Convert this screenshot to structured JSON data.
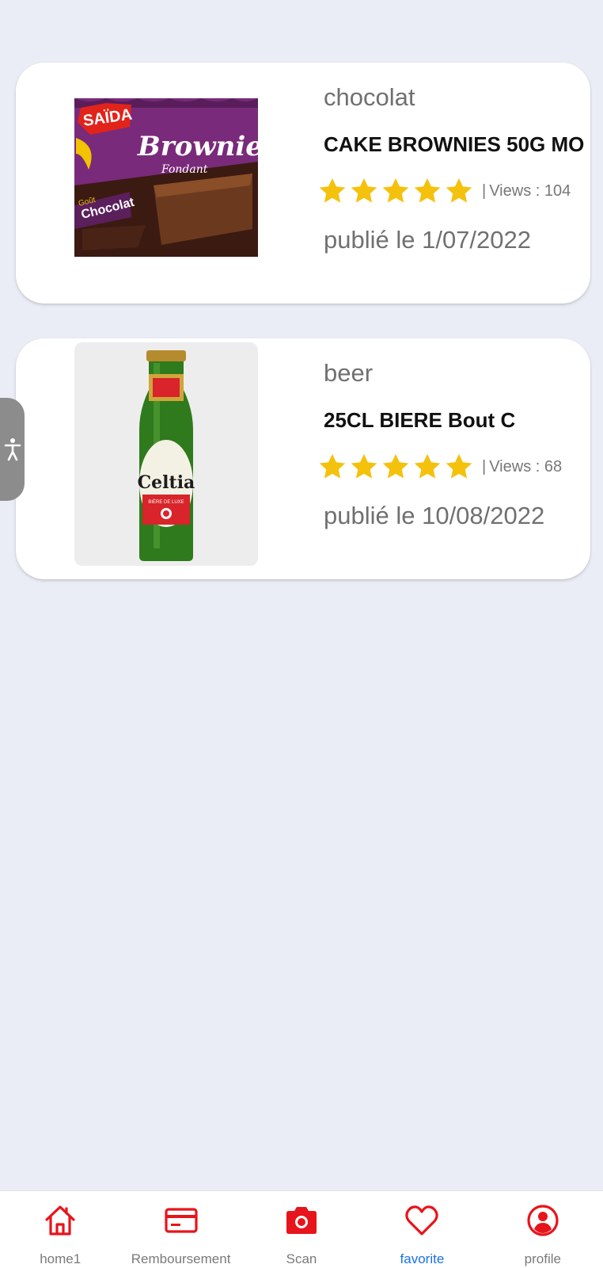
{
  "colors": {
    "accent_red": "#e8141b",
    "star_gold": "#f4c20d",
    "active_blue": "#1a73e8",
    "background": "#eaedf5"
  },
  "products": [
    {
      "category": "chocolat",
      "title": "CAKE BROWNIES 50G MO",
      "rating": 5,
      "views_label": "Views : 104",
      "date": "publié le 1/07/2022",
      "image": {
        "brand": "SAÏDA",
        "name": "Brownie",
        "subname": "Fondant",
        "flavor_1": "Goût",
        "flavor_2": "Chocolat"
      }
    },
    {
      "category": "beer",
      "title": "25CL BIERE Bout C",
      "rating": 5,
      "views_label": "Views : 68",
      "date": "publié le 10/08/2022",
      "image": {
        "brand": "Celtia",
        "subname": "BIÈRE DE LUXE"
      }
    }
  ],
  "accessibility": {
    "icon": "accessibility-icon"
  },
  "nav": {
    "items": [
      {
        "label": "home1",
        "icon": "home-icon"
      },
      {
        "label": "Remboursement",
        "icon": "card-icon"
      },
      {
        "label": "Scan",
        "icon": "camera-icon"
      },
      {
        "label": "favorite",
        "icon": "heart-icon"
      },
      {
        "label": "profile",
        "icon": "profile-icon"
      }
    ],
    "active": "favorite"
  }
}
